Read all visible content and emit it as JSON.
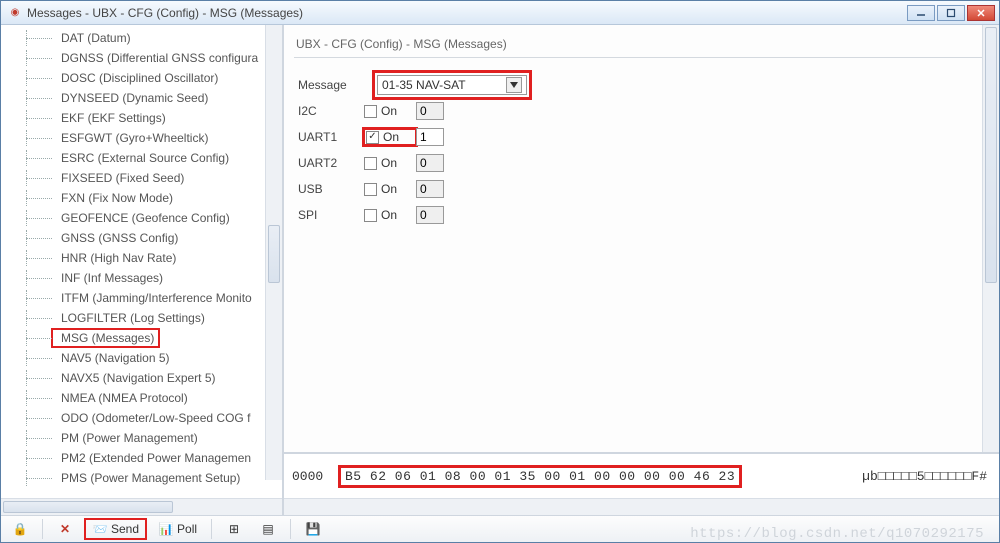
{
  "window": {
    "title": "Messages - UBX - CFG (Config) - MSG (Messages)"
  },
  "tree": {
    "items": [
      "DAT (Datum)",
      "DGNSS (Differential GNSS configura",
      "DOSC (Disciplined Oscillator)",
      "DYNSEED (Dynamic Seed)",
      "EKF (EKF Settings)",
      "ESFGWT (Gyro+Wheeltick)",
      "ESRC (External Source Config)",
      "FIXSEED (Fixed Seed)",
      "FXN (Fix Now Mode)",
      "GEOFENCE (Geofence Config)",
      "GNSS (GNSS Config)",
      "HNR (High Nav Rate)",
      "INF (Inf Messages)",
      "ITFM (Jamming/Interference Monito",
      "LOGFILTER (Log Settings)",
      "MSG (Messages)",
      "NAV5 (Navigation 5)",
      "NAVX5 (Navigation Expert 5)",
      "NMEA (NMEA Protocol)",
      "ODO (Odometer/Low-Speed COG f",
      "PM (Power Management)",
      "PM2 (Extended Power Managemen",
      "PMS (Power Management Setup)"
    ],
    "selected_index": 15
  },
  "cfg": {
    "breadcrumb": "UBX - CFG (Config) - MSG (Messages)",
    "message_label": "Message",
    "message_value": "01-35 NAV-SAT",
    "on_label": "On",
    "ports": [
      {
        "name": "I2C",
        "on": false,
        "value": "0",
        "active": false,
        "highlight": false
      },
      {
        "name": "UART1",
        "on": true,
        "value": "1",
        "active": true,
        "highlight": true
      },
      {
        "name": "UART2",
        "on": false,
        "value": "0",
        "active": false,
        "highlight": false
      },
      {
        "name": "USB",
        "on": false,
        "value": "0",
        "active": false,
        "highlight": false
      },
      {
        "name": "SPI",
        "on": false,
        "value": "0",
        "active": false,
        "highlight": false
      }
    ]
  },
  "hex": {
    "offset": "0000",
    "bytes": "B5 62 06 01 08 00 01 35 00 01 00 00 00 00 46 23",
    "ascii": "µb□□□□□5□□□□□□F#"
  },
  "toolbar": {
    "send": "Send",
    "poll": "Poll"
  },
  "watermark": "https://blog.csdn.net/q1070292175"
}
